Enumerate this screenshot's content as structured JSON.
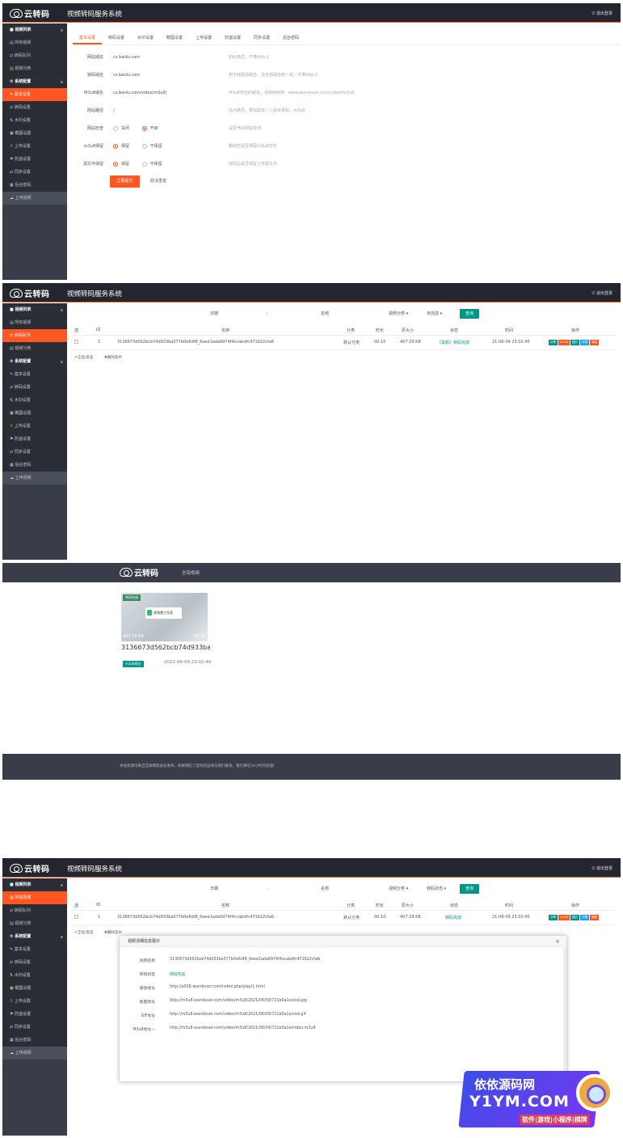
{
  "app": {
    "brand": "云转码",
    "title": "视频转码服务系统",
    "logout": "退出登录"
  },
  "sidebar": {
    "groups": [
      {
        "label": "视频列表",
        "items": [
          "所有视频",
          "转码队列",
          "视频分类"
        ]
      },
      {
        "label": "系统配置",
        "items": [
          "基本设置",
          "转码设置",
          "水印设置",
          "截图设置",
          "上传设置",
          "防盗设置",
          "同步设置",
          "后台密码"
        ]
      }
    ],
    "upload": "上传视频"
  },
  "settings": {
    "tabs": [
      "基本设置",
      "转码设置",
      "水印设置",
      "截图设置",
      "上传设置",
      "防盗设置",
      "同步设置",
      "后台密码"
    ],
    "fields": [
      {
        "label": "网站域名",
        "value": "cs.baidu.com",
        "hint": "如此格式，不带http://"
      },
      {
        "label": "转码域名",
        "value": "cs.baidu.com",
        "hint": "用于转码的域名，请全部域名统一起，不带http://"
      },
      {
        "label": "M3u8域名",
        "value": "cs.baidu.com/video/m3u8/",
        "hint": "M3u8地址的域名，请使用转换：www.wandouer.com/video/m3u8"
      },
      {
        "label": "网站路径",
        "value": "/",
        "hint": "站点路径，要加尾部 / 二级目录如：m3u8"
      }
    ],
    "radios": [
      {
        "label": "网站检查",
        "opt1": "关闭",
        "opt2": "开启",
        "selected": 2,
        "hint": "是否开启网站检测"
      },
      {
        "label": "m3u8保留",
        "opt1": "保留",
        "opt2": "不保留",
        "selected": 1,
        "hint": "删除时是否保留m3u8文件"
      },
      {
        "label": "源文件保留",
        "opt1": "保留",
        "opt2": "不保留",
        "selected": 1,
        "hint": "转码后是否保留上传源文件"
      }
    ],
    "submit": "立即提交",
    "reset": "取消重置"
  },
  "queue": {
    "filters": {
      "date": "日期",
      "dash": "-",
      "name": "名称",
      "category": "视频分类",
      "status": "未完成",
      "search": "查询"
    },
    "headers": [
      "选",
      "ID",
      "名称",
      "分类",
      "时长",
      "原大小",
      "状态",
      "时间",
      "操作"
    ],
    "row": {
      "id": "1",
      "name": "3136673d562bcb74d933ba577b0e6df8_6eee1ada6974f4ccabdfc471622cfa6",
      "category": "默认分类",
      "duration": "00:10",
      "size": "407.29 KB",
      "status": "《黑瓶》转码完成",
      "time": "21-06-09 23:02:40"
    },
    "ops": [
      "分享",
      "m3u8",
      "图片",
      "详情",
      "删除"
    ],
    "bulk": [
      "全选/反选",
      "删除选中"
    ]
  },
  "gallery": {
    "brand": "云转码",
    "nav": "全部视频",
    "video": {
      "tag": "转码完成",
      "card": "视频素工作室",
      "size": "407.29 KB",
      "duration": "00:10",
      "title": "3136673d562bcb74d933ba5...",
      "badge": "m3u8地址",
      "date": "2021-06-09 23:02:40"
    },
    "footer": "本站资源均来自互联网或会员发布，如果侵犯了您的权益请与我们联系，我们将在24小时内处理!"
  },
  "all_videos": {
    "filters": {
      "date": "日期",
      "dash": "-",
      "name": "名称",
      "category": "视频分类",
      "status": "转码状态",
      "search": "查询"
    },
    "row": {
      "id": "1",
      "name": "3136673d562bcb74d933ba577b0e6df8_6eee1ada6974f4ccabdfc471622cfa6",
      "category": "默认分类",
      "duration": "00:10",
      "size": "407.29 KB",
      "status": "转码完成",
      "time": "21-06-09 23:02:40"
    },
    "bulk": [
      "全选/反选",
      "删除选中"
    ]
  },
  "modal": {
    "title": "视频详细信息展示",
    "close": "×",
    "rows": [
      {
        "label": "视频名称",
        "value": "3136673d562bcb74d933ba577b0e6df8_6eee1ada6974f4ccabdfc471622cfa6"
      },
      {
        "label": "转码状态",
        "value": "转码完成"
      },
      {
        "label": "播放地址",
        "value": "http://a016.wandouer.com/index.php/play/1.html"
      },
      {
        "label": "截图地址",
        "value": "http://m3u8.wandouer.com/video/m3u8/2021/06/09/721b0a1e/vod.jpg"
      },
      {
        "label": "GIF地址",
        "value": "http://m3u8.wandouer.com/video/m3u8/2021/06/09/721b0a1e/vod.gif"
      },
      {
        "label": "M3u8地址一",
        "value": "http://m3u8.wandouer.com/video/m3u8/2021/06/09/721b0a1e/index.m3u8"
      }
    ]
  },
  "watermark": {
    "line1": "依依源码网",
    "line2": "Y1YM.COM",
    "line3": "软件|游戏|小程序|棋牌"
  },
  "colors": {
    "accent": "#ff5722",
    "teal": "#009688",
    "sidebar": "#393d49",
    "topbar": "#23262e"
  }
}
